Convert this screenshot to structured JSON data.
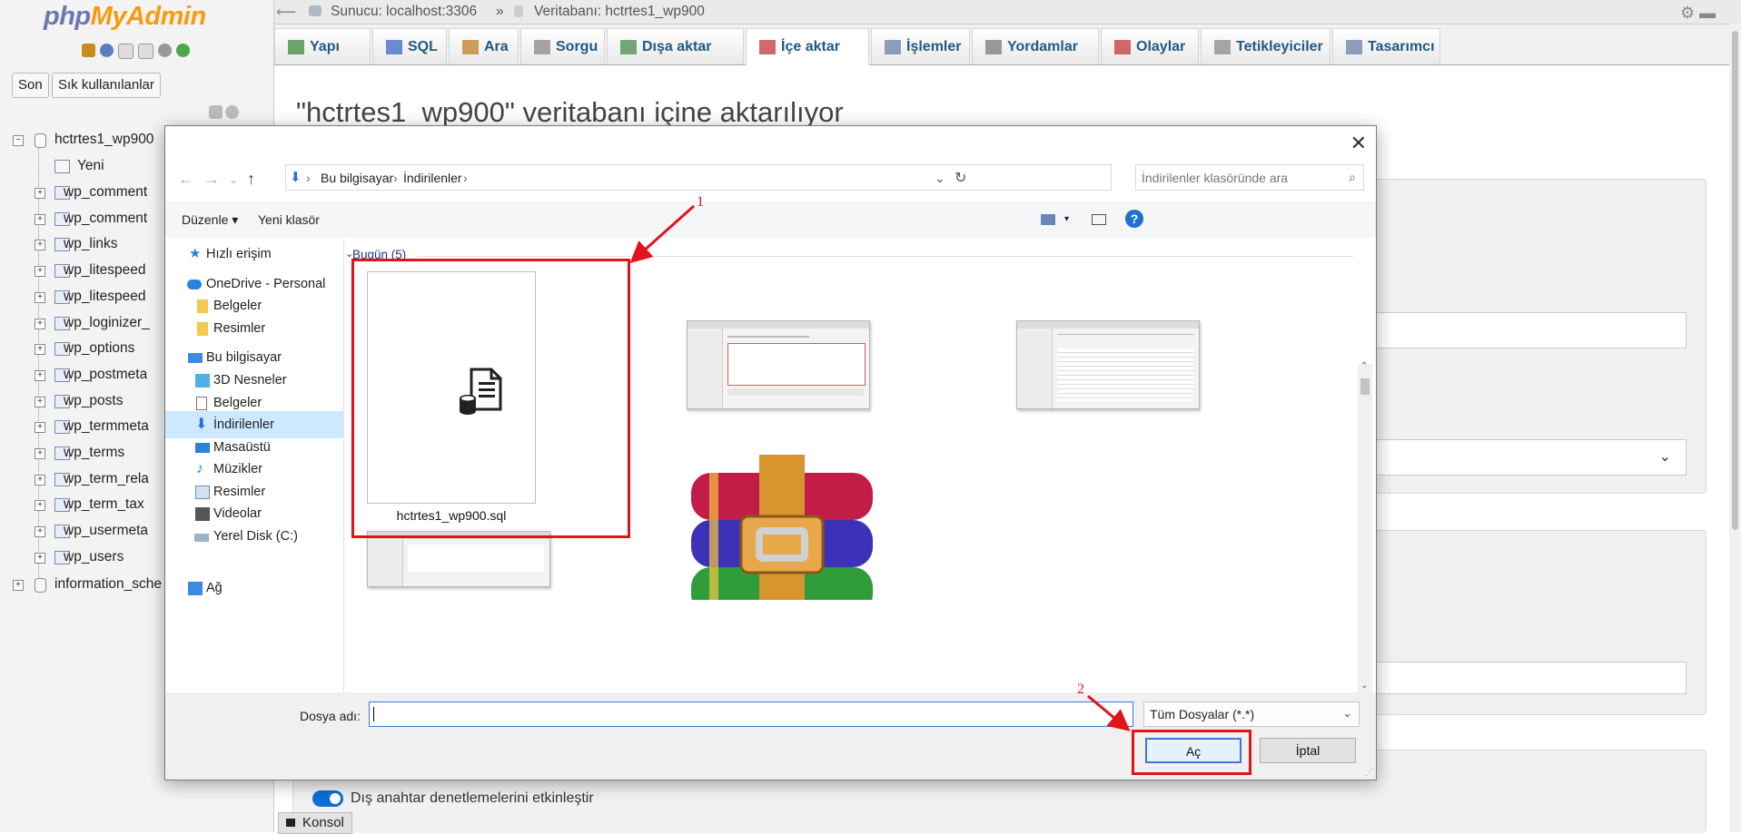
{
  "pma": {
    "logo_php": "php",
    "logo_myadmin": "MyAdmin",
    "recent_tab": "Son",
    "favorites_tab": "Sık kullanılanlar",
    "tree": {
      "db1": "hctrtes1_wp900",
      "new": "Yeni",
      "tables": [
        "wp_comment",
        "wp_comment",
        "wp_links",
        "wp_litespeed",
        "wp_litespeed",
        "wp_loginizer_",
        "wp_options",
        "wp_postmeta",
        "wp_posts",
        "wp_termmeta",
        "wp_terms",
        "wp_term_rela",
        "wp_term_tax",
        "wp_usermeta",
        "wp_users"
      ],
      "db2": "information_sche"
    },
    "breadcrumb": {
      "server": "Sunucu: localhost:3306",
      "sep": "»",
      "database": "Veritabanı: hctrtes1_wp900"
    },
    "tabs": [
      "Yapı",
      "SQL",
      "Ara",
      "Sorgu",
      "Dışa aktar",
      "İçe aktar",
      "İşlemler",
      "Yordamlar",
      "Olaylar",
      "Tetikleyiciler",
      "Tasarımcı"
    ],
    "active_tab": "İçe aktar",
    "page_title": "\"hctrtes1_wp900\" veritabanı içine aktarılıyor",
    "fk_label": "Dış anahtar denetlemelerini etkinleştir",
    "console": "Konsol"
  },
  "dialog": {
    "address": {
      "seg1": "Bu bilgisayar",
      "seg2": "İndirilenler"
    },
    "search_placeholder": "İndirilenler klasöründe ara",
    "organize": "Düzenle",
    "new_folder": "Yeni klasör",
    "nav": {
      "quick_access": "Hızlı erişim",
      "onedrive": "OneDrive - Personal",
      "od_docs": "Belgeler",
      "od_pics": "Resimler",
      "this_pc": "Bu bilgisayar",
      "objects3d": "3D Nesneler",
      "docs": "Belgeler",
      "downloads": "İndirilenler",
      "desktop": "Masaüstü",
      "music": "Müzikler",
      "pictures": "Resimler",
      "videos": "Videolar",
      "local_disk": "Yerel Disk (C:)",
      "network": "Ağ"
    },
    "group_header": "Bugün (5)",
    "file1": "hctrtes1_wp900.sql",
    "filename_label": "Dosya adı:",
    "filename_value": "",
    "filter": "Tüm Dosyalar (*.*)",
    "open": "Aç",
    "cancel": "İptal"
  },
  "annotations": {
    "a1": "1",
    "a2": "2"
  },
  "colors": {
    "annotation_red": "#e0141b",
    "pma_link": "#235a81",
    "selection": "#cde8ff"
  }
}
